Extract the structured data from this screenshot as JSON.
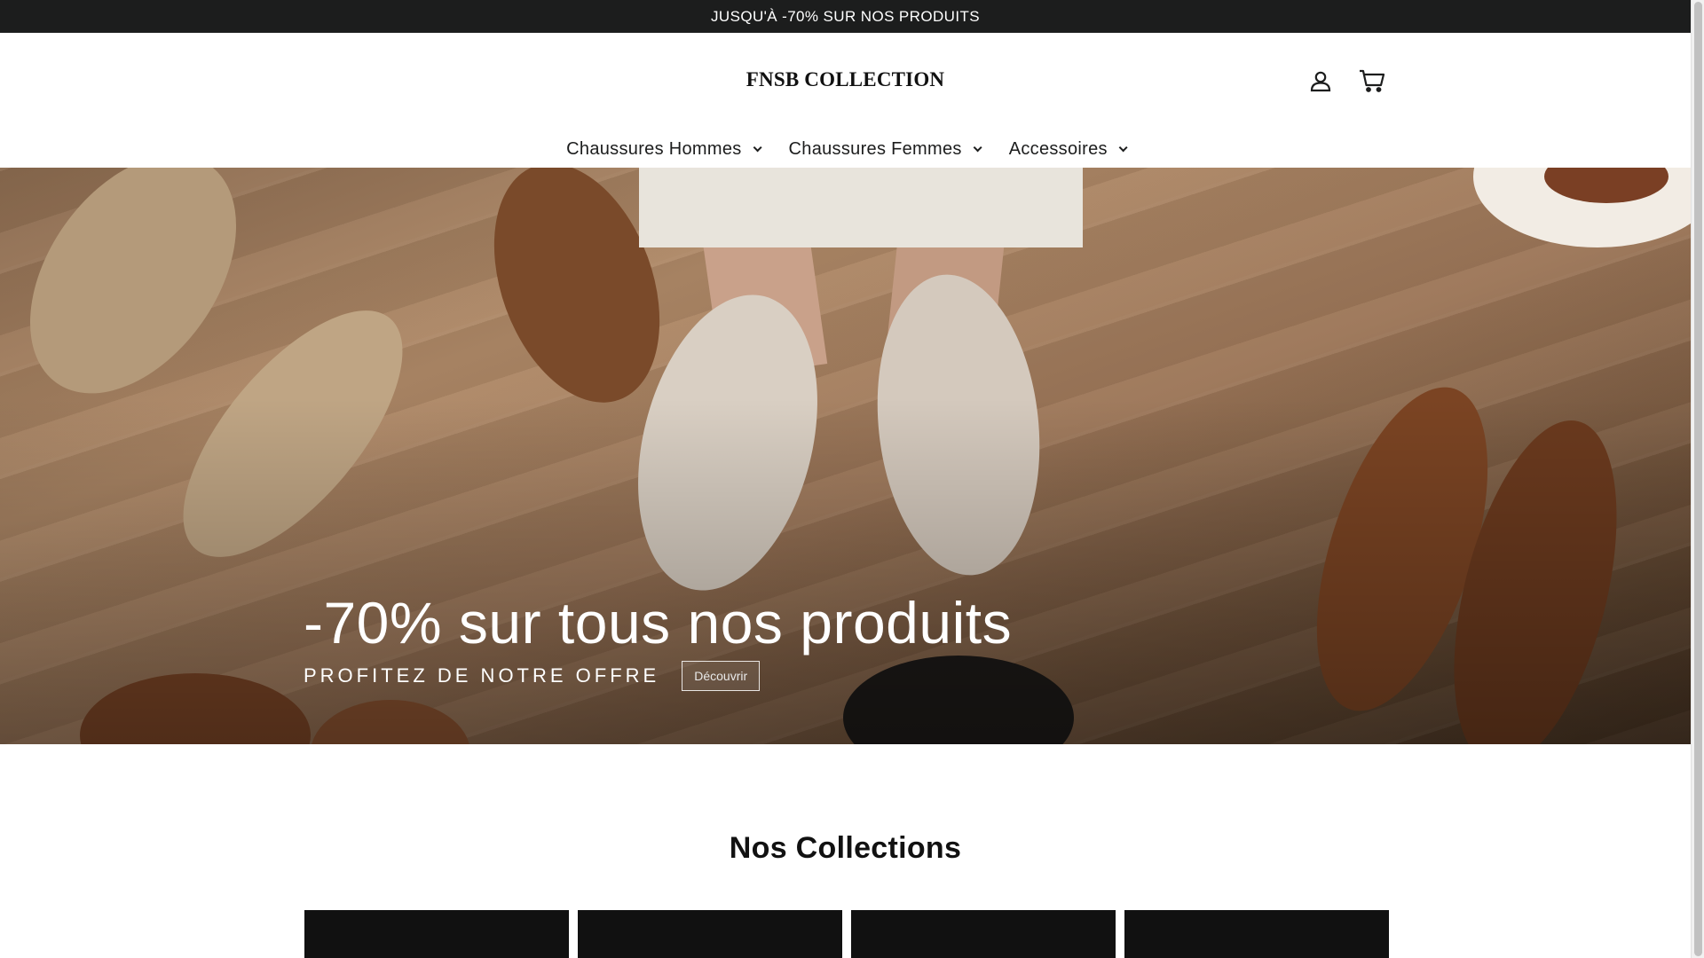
{
  "announcement": {
    "text": "JUSQU'À -70% SUR NOS PRODUITS"
  },
  "header": {
    "logo": "FNSB COLLECTION",
    "icons": {
      "account": "user-icon",
      "cart": "cart-icon"
    }
  },
  "nav": {
    "items": [
      {
        "label": "Chaussures Hommes"
      },
      {
        "label": "Chaussures Femmes"
      },
      {
        "label": "Accessoires"
      }
    ]
  },
  "hero": {
    "title": "-70% sur tous nos produits",
    "subtitle": "PROFITEZ DE NOTRE OFFRE",
    "button_label": "Découvrir"
  },
  "collections": {
    "title": "Nos Collections",
    "card_color": "#111111",
    "cards": [
      "",
      "",
      "",
      ""
    ]
  },
  "colors": {
    "announcement_bg": "#1c1d1d",
    "text": "#1c1d1d"
  }
}
